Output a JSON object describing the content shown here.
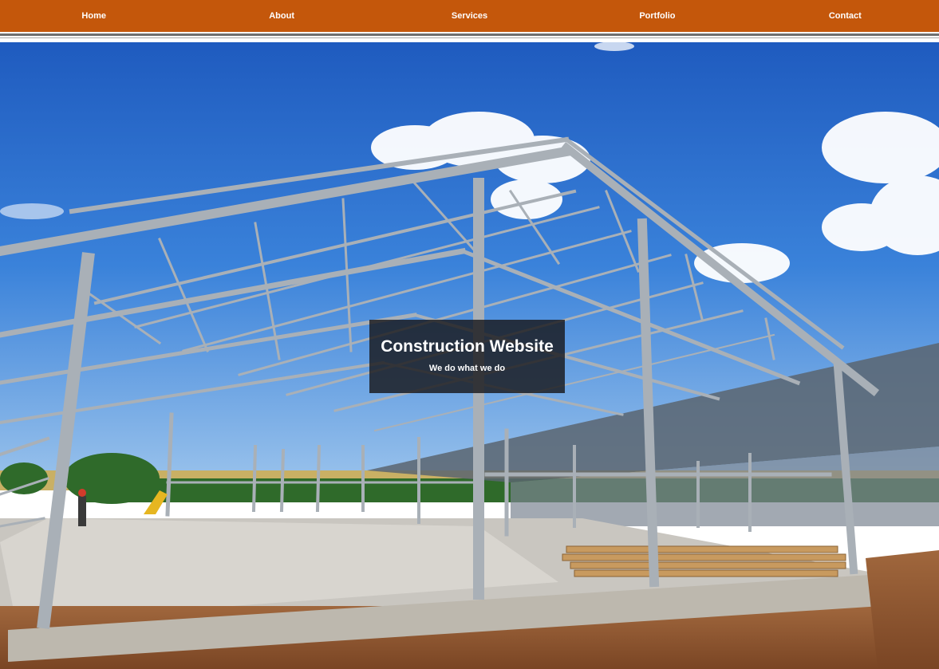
{
  "nav": {
    "items": [
      "Home",
      "About",
      "Services",
      "Portfolio",
      "Contact"
    ]
  },
  "hero": {
    "title": "Construction Website",
    "subtitle": "We do what we do",
    "image": "steel-frame-building-under-construction"
  },
  "colors": {
    "nav_bg": "#c4570b",
    "nav_text": "#ffffff",
    "divider": "#6e6e6e",
    "overlay": "#19191c",
    "sky": "#2d6fcf",
    "steel": "#aab1b8"
  }
}
